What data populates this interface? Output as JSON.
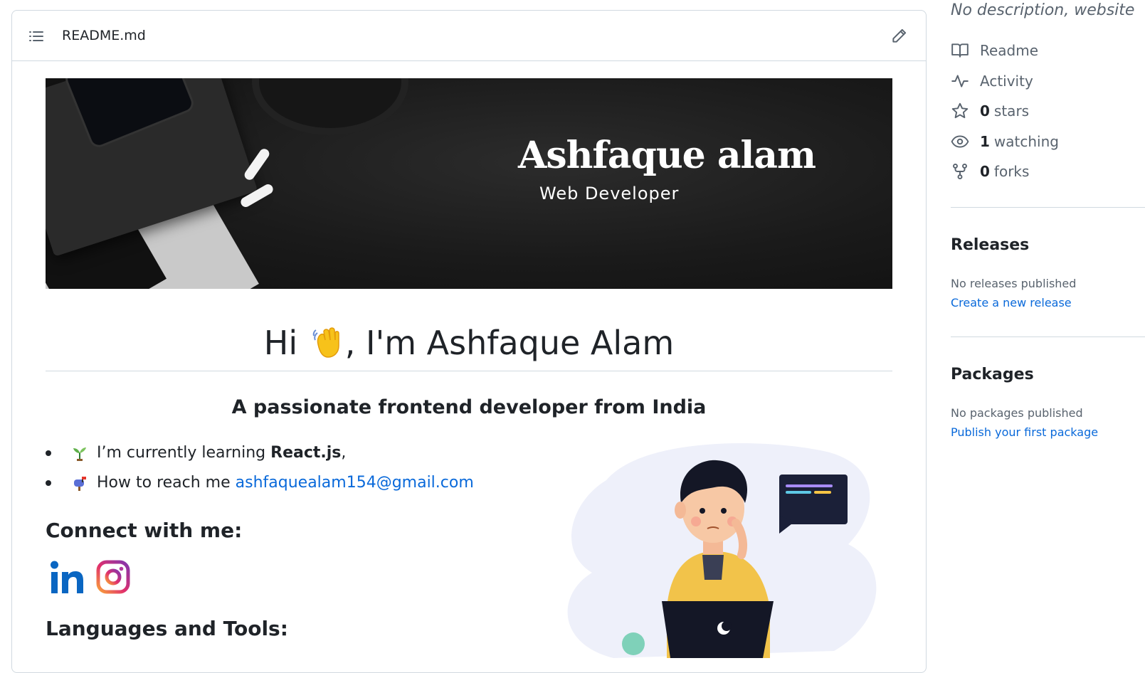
{
  "readme": {
    "filename": "README.md",
    "banner": {
      "name": "Ashfaque alam",
      "subtitle": "Web Developer"
    },
    "heading": {
      "before": "Hi",
      "after": ", I'm Ashfaque Alam"
    },
    "tagline": "A passionate frontend developer from India",
    "bullets": [
      {
        "icon": "seedling-icon",
        "text": "I’m currently learning ",
        "bold": "React.js",
        "tail": ","
      },
      {
        "icon": "mailbox-icon",
        "text": "How to reach me ",
        "link": "ashfaquealam154@gmail.com"
      }
    ],
    "connect_heading": "Connect with me:",
    "social": [
      "linkedin-icon",
      "instagram-icon"
    ],
    "languages_heading": "Languages and Tools:"
  },
  "sidebar": {
    "description": "No description, website",
    "links": [
      {
        "icon": "book-icon",
        "count": "",
        "label": "Readme"
      },
      {
        "icon": "pulse-icon",
        "count": "",
        "label": "Activity"
      },
      {
        "icon": "star-icon",
        "count": "0",
        "label": "stars"
      },
      {
        "icon": "eye-icon",
        "count": "1",
        "label": "watching"
      },
      {
        "icon": "fork-icon",
        "count": "0",
        "label": "forks"
      }
    ],
    "releases": {
      "title": "Releases",
      "empty": "No releases published",
      "action": "Create a new release"
    },
    "packages": {
      "title": "Packages",
      "empty": "No packages published",
      "action": "Publish your first package"
    }
  },
  "colors": {
    "link": "#0969da",
    "border": "#d1d9e0",
    "muted": "#59636e",
    "text": "#1f2328"
  }
}
